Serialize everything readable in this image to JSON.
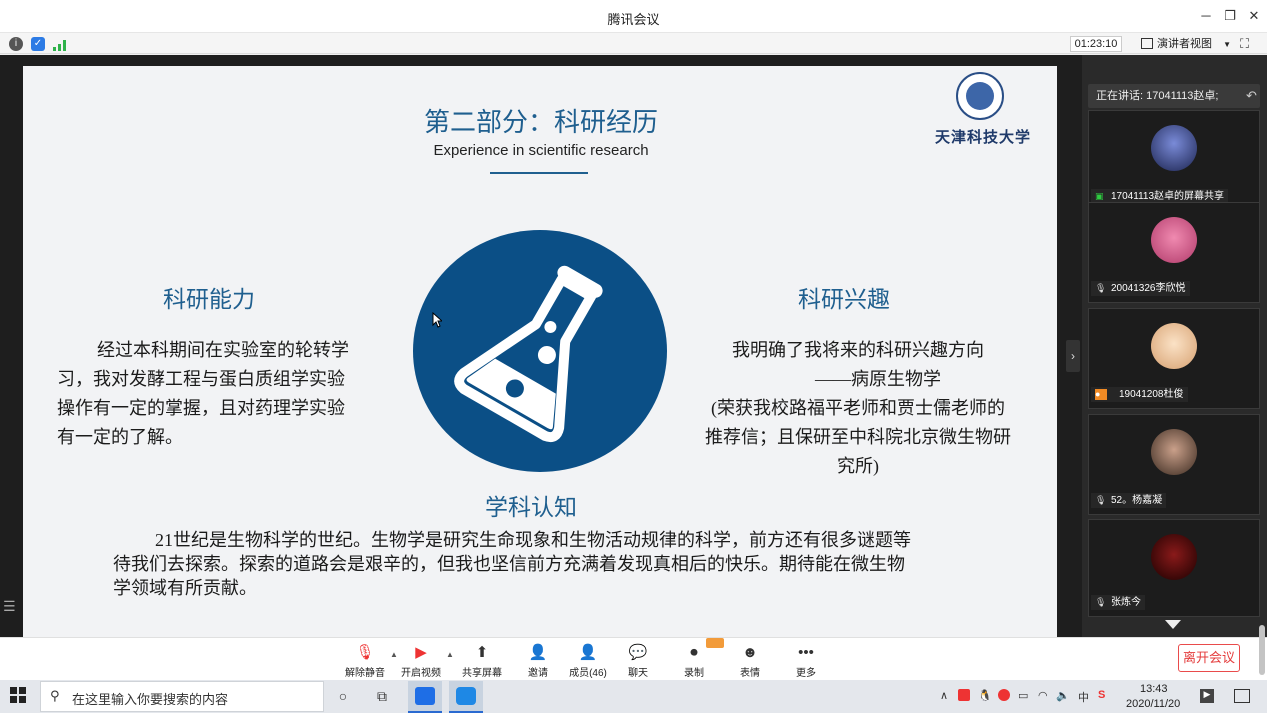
{
  "window": {
    "title": "腾讯会议"
  },
  "topbar": {
    "timer": "01:23:10",
    "presenter_view": "演讲者视图"
  },
  "slide": {
    "title": "第二部分：科研经历",
    "subtitle": "Experience in scientific research",
    "university": "天津科技大学",
    "left_heading": "科研能力",
    "left_lines": [
      "经过本科期间在实验室的轮转学",
      "习，我对发酵工程与蛋白质组学实验",
      "操作有一定的掌握，且对药理学实验",
      "有一定的了解。"
    ],
    "right_heading": "科研兴趣",
    "right_lines": [
      "我明确了我将来的科研兴趣方向",
      "——病原生物学",
      "(荣获我校路福平老师和贾士儒老师的",
      "推荐信；且保研至中科院北京微生物研",
      "究所)"
    ],
    "bottom_heading": "学科认知",
    "bottom_lines": [
      "21世纪是生物科学的世纪。生物学是研究生命现象和生物活动规律的科学，前方还有很多谜题等",
      "待我们去探索。探索的道路会是艰辛的，但我也坚信前方充满着发现真相后的快乐。期待能在微生物",
      "学领域有所贡献。"
    ]
  },
  "panel": {
    "speaking": "正在讲话: 17041113赵卓;",
    "participants": [
      {
        "name": "17041113赵卓的屏幕共享",
        "avatar_color": "#2a3a6a"
      },
      {
        "name": "20041326李欣悦",
        "avatar_color": "#d65a8a"
      },
      {
        "name": "19041208杜俊",
        "avatar_color": "#e8c7a0"
      },
      {
        "name": "52。杨嘉凝",
        "avatar_color": "#6a4a3a"
      },
      {
        "name": "张炼今",
        "avatar_color": "#3a0a0a"
      }
    ]
  },
  "meetbar": {
    "mute": "解除静音",
    "video": "开启视频",
    "share": "共享屏幕",
    "invite": "邀请",
    "members": "成员(46)",
    "chat": "聊天",
    "record": "录制",
    "emoji": "表情",
    "more": "更多",
    "leave": "离开会议"
  },
  "taskbar": {
    "search_placeholder": "在这里输入你要搜索的内容",
    "time": "13:43",
    "date": "2020/11/20",
    "ime": "中"
  },
  "colors": {
    "accent_blue": "#1f5f8f",
    "circle_blue": "#0b4f86",
    "leave_red": "#e43c3c"
  }
}
